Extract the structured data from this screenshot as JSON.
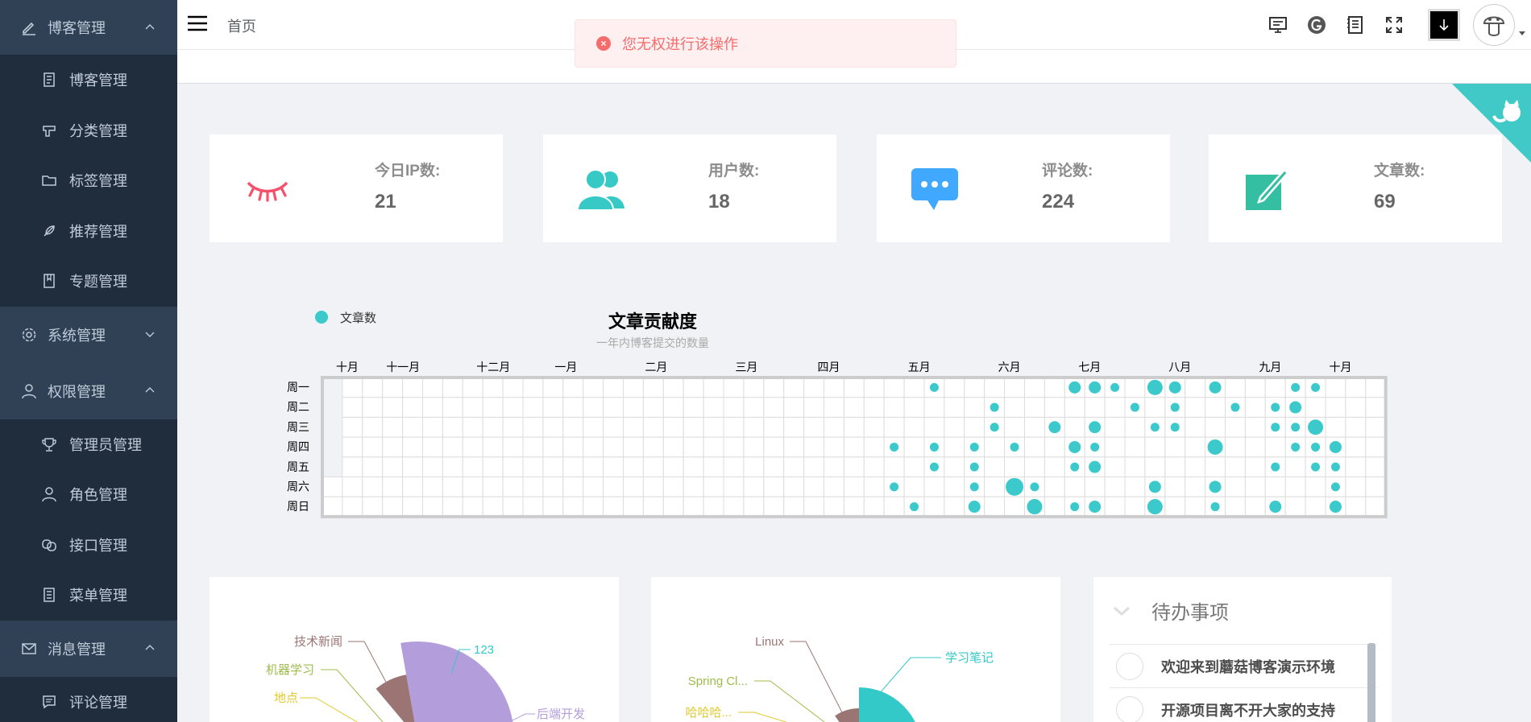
{
  "sidebar": {
    "blog_group": "博客管理",
    "blog_items": [
      "博客管理",
      "分类管理",
      "标签管理",
      "推荐管理",
      "专题管理"
    ],
    "system_group": "系统管理",
    "auth_group": "权限管理",
    "auth_items": [
      "管理员管理",
      "角色管理",
      "接口管理",
      "菜单管理"
    ],
    "msg_group": "消息管理",
    "msg_items": [
      "评论管理"
    ]
  },
  "header": {
    "breadcrumb": "首页"
  },
  "toast": {
    "message": "您无权进行该操作",
    "color": "#f56c6c"
  },
  "stats": [
    {
      "label": "今日IP数:",
      "value": "21",
      "icon": "eye-closed-icon",
      "color": "#f4516c"
    },
    {
      "label": "用户数:",
      "value": "18",
      "icon": "users-icon",
      "color": "#36c9c6"
    },
    {
      "label": "评论数:",
      "value": "224",
      "icon": "message-icon",
      "color": "#40a9ff"
    },
    {
      "label": "文章数:",
      "value": "69",
      "icon": "edit-icon",
      "color": "#34bfa3"
    }
  ],
  "chart_data": {
    "type": "scatter",
    "title": "文章贡献度",
    "subtitle": "一年内博客提交的数量",
    "legend": [
      "文章数"
    ],
    "legend_position": "top-left",
    "color": "#3cc9cc",
    "months": [
      "十月",
      "十一月",
      "十二月",
      "一月",
      "二月",
      "三月",
      "四月",
      "五月",
      "六月",
      "七月",
      "八月",
      "九月",
      "十月"
    ],
    "weekdays": [
      "周一",
      "周二",
      "周三",
      "周四",
      "周五",
      "周六",
      "周日"
    ],
    "points": [
      {
        "week": 30,
        "day": 0,
        "v": 1
      },
      {
        "week": 37,
        "day": 0,
        "v": 2
      },
      {
        "week": 38,
        "day": 0,
        "v": 2
      },
      {
        "week": 39,
        "day": 0,
        "v": 1
      },
      {
        "week": 41,
        "day": 0,
        "v": 3
      },
      {
        "week": 42,
        "day": 0,
        "v": 2
      },
      {
        "week": 44,
        "day": 0,
        "v": 2
      },
      {
        "week": 48,
        "day": 0,
        "v": 1
      },
      {
        "week": 49,
        "day": 0,
        "v": 1
      },
      {
        "week": 33,
        "day": 1,
        "v": 1
      },
      {
        "week": 40,
        "day": 1,
        "v": 1
      },
      {
        "week": 42,
        "day": 1,
        "v": 1
      },
      {
        "week": 45,
        "day": 1,
        "v": 1
      },
      {
        "week": 47,
        "day": 1,
        "v": 1
      },
      {
        "week": 48,
        "day": 1,
        "v": 2
      },
      {
        "week": 33,
        "day": 2,
        "v": 1
      },
      {
        "week": 36,
        "day": 2,
        "v": 2
      },
      {
        "week": 38,
        "day": 2,
        "v": 2
      },
      {
        "week": 41,
        "day": 2,
        "v": 1
      },
      {
        "week": 42,
        "day": 2,
        "v": 1
      },
      {
        "week": 47,
        "day": 2,
        "v": 1
      },
      {
        "week": 48,
        "day": 2,
        "v": 1
      },
      {
        "week": 49,
        "day": 2,
        "v": 3
      },
      {
        "week": 28,
        "day": 3,
        "v": 1
      },
      {
        "week": 30,
        "day": 3,
        "v": 1
      },
      {
        "week": 32,
        "day": 3,
        "v": 1
      },
      {
        "week": 34,
        "day": 3,
        "v": 1
      },
      {
        "week": 37,
        "day": 3,
        "v": 2
      },
      {
        "week": 38,
        "day": 3,
        "v": 1
      },
      {
        "week": 44,
        "day": 3,
        "v": 3
      },
      {
        "week": 48,
        "day": 3,
        "v": 1
      },
      {
        "week": 49,
        "day": 3,
        "v": 1
      },
      {
        "week": 50,
        "day": 3,
        "v": 2
      },
      {
        "week": 30,
        "day": 4,
        "v": 1
      },
      {
        "week": 32,
        "day": 4,
        "v": 1
      },
      {
        "week": 37,
        "day": 4,
        "v": 1
      },
      {
        "week": 38,
        "day": 4,
        "v": 2
      },
      {
        "week": 47,
        "day": 4,
        "v": 1
      },
      {
        "week": 49,
        "day": 4,
        "v": 1
      },
      {
        "week": 50,
        "day": 4,
        "v": 1
      },
      {
        "week": 28,
        "day": 5,
        "v": 1
      },
      {
        "week": 32,
        "day": 5,
        "v": 1
      },
      {
        "week": 34,
        "day": 5,
        "v": 4
      },
      {
        "week": 35,
        "day": 5,
        "v": 1
      },
      {
        "week": 41,
        "day": 5,
        "v": 2
      },
      {
        "week": 44,
        "day": 5,
        "v": 2
      },
      {
        "week": 50,
        "day": 5,
        "v": 1
      },
      {
        "week": 29,
        "day": 6,
        "v": 1
      },
      {
        "week": 32,
        "day": 6,
        "v": 2
      },
      {
        "week": 35,
        "day": 6,
        "v": 3
      },
      {
        "week": 37,
        "day": 6,
        "v": 1
      },
      {
        "week": 38,
        "day": 6,
        "v": 2
      },
      {
        "week": 41,
        "day": 6,
        "v": 3
      },
      {
        "week": 44,
        "day": 6,
        "v": 1
      },
      {
        "week": 47,
        "day": 6,
        "v": 2
      },
      {
        "week": 50,
        "day": 6,
        "v": 2
      }
    ]
  },
  "pie1": {
    "labels": [
      "技术新闻",
      "机器学习",
      "地点",
      "123",
      "后端开发"
    ],
    "colors": [
      "#9a7574",
      "#9cbc4b",
      "#e3c82d",
      "#33c9c8",
      "#b39ddb"
    ]
  },
  "pie2": {
    "labels": [
      "Linux",
      "Spring Cl...",
      "哈哈哈...",
      "学习笔记"
    ],
    "colors": [
      "#9a7574",
      "#9cbc4b",
      "#e3c82d",
      "#33c9c8"
    ]
  },
  "todo": {
    "title": "待办事项",
    "items": [
      "欢迎来到蘑菇博客演示环境",
      "开源项目离不开大家的支持"
    ]
  }
}
